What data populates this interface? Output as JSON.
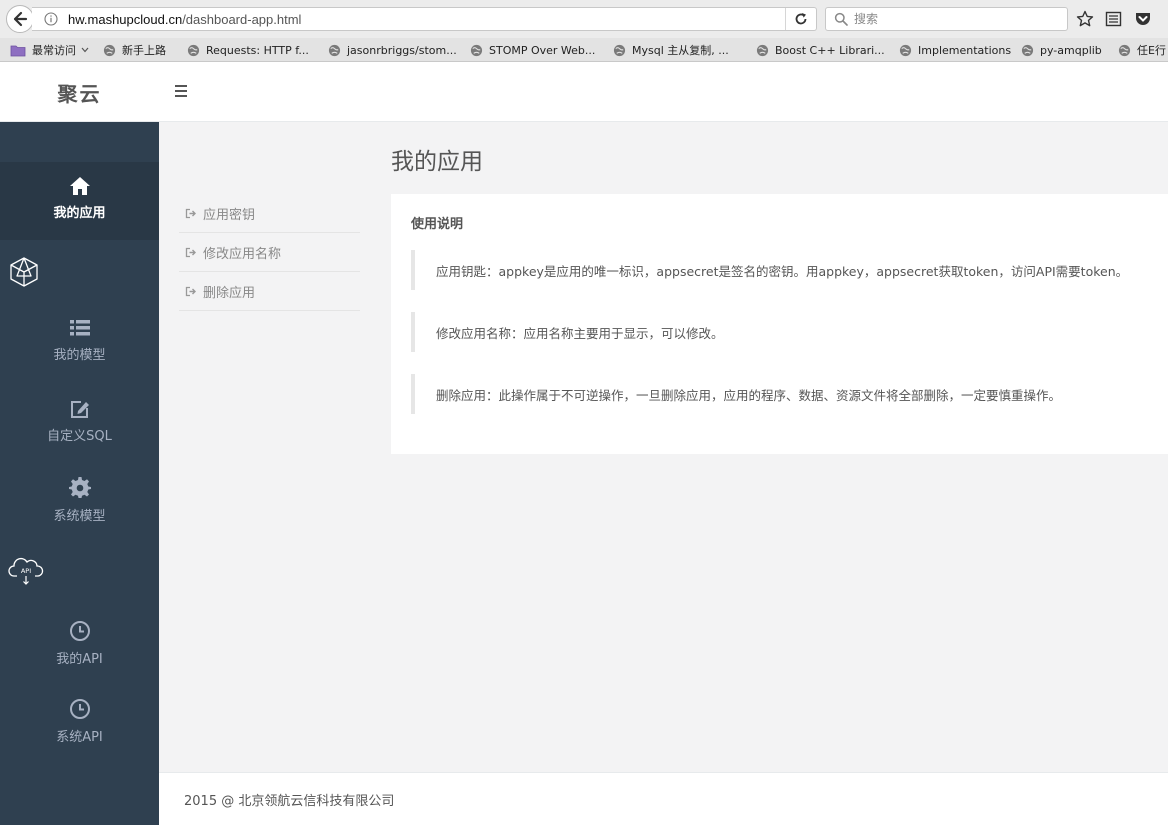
{
  "browser": {
    "url_host": "hw.mashupcloud.cn",
    "url_path": "/dashboard-app.html",
    "search_placeholder": "搜索",
    "bookmarks": [
      {
        "label": "最常访问",
        "icon": "folder-icon",
        "dropdown": true
      },
      {
        "label": "新手上路",
        "icon": "globe-icon"
      },
      {
        "label": "Requests: HTTP f...",
        "icon": "globe-icon"
      },
      {
        "label": "jasonrbriggs/stom...",
        "icon": "globe-icon"
      },
      {
        "label": "STOMP Over Web...",
        "icon": "globe-icon"
      },
      {
        "label": "Mysql 主从复制, ...",
        "icon": "globe-icon"
      },
      {
        "label": "Boost C++ Librari...",
        "icon": "globe-icon"
      },
      {
        "label": "Implementations",
        "icon": "globe-icon"
      },
      {
        "label": "py-amqplib",
        "icon": "globe-icon"
      },
      {
        "label": "任E行",
        "icon": "globe-icon"
      }
    ]
  },
  "header": {
    "brand": "聚云"
  },
  "sidebar": {
    "items": [
      {
        "label": "我的应用",
        "icon": "home-icon",
        "active": true
      },
      {
        "label": "我的模型",
        "icon": "list-icon",
        "active": false
      },
      {
        "label": "自定义SQL",
        "icon": "edit-icon",
        "active": false
      },
      {
        "label": "系统模型",
        "icon": "gear-icon",
        "active": false
      },
      {
        "label": "我的API",
        "icon": "clock-icon",
        "active": false
      },
      {
        "label": "系统API",
        "icon": "clock-icon",
        "active": false
      }
    ],
    "section_icons": [
      "cube-icon",
      "cloud-api-icon"
    ],
    "cloud_icon_text": "API"
  },
  "sub_menu": {
    "items": [
      {
        "label": "应用密钥",
        "icon": "sign-out-icon"
      },
      {
        "label": "修改应用名称",
        "icon": "sign-out-icon"
      },
      {
        "label": "删除应用",
        "icon": "sign-out-icon"
      }
    ]
  },
  "main": {
    "title": "我的应用",
    "card": {
      "title": "使用说明",
      "notes": [
        "应用钥匙：appkey是应用的唯一标识，appsecret是签名的密钥。用appkey，appsecret获取token，访问API需要token。",
        "修改应用名称：应用名称主要用于显示，可以修改。",
        "删除应用：此操作属于不可逆操作，一旦删除应用，应用的程序、数据、资源文件将全部删除，一定要慎重操作。"
      ]
    }
  },
  "footer": {
    "text": "2015 @ 北京领航云信科技有限公司"
  },
  "colors": {
    "sidebar_bg": "#2f4050",
    "sidebar_active_bg": "#293846",
    "sidebar_text": "#a7b1c2",
    "main_bg": "#f3f3f4"
  }
}
